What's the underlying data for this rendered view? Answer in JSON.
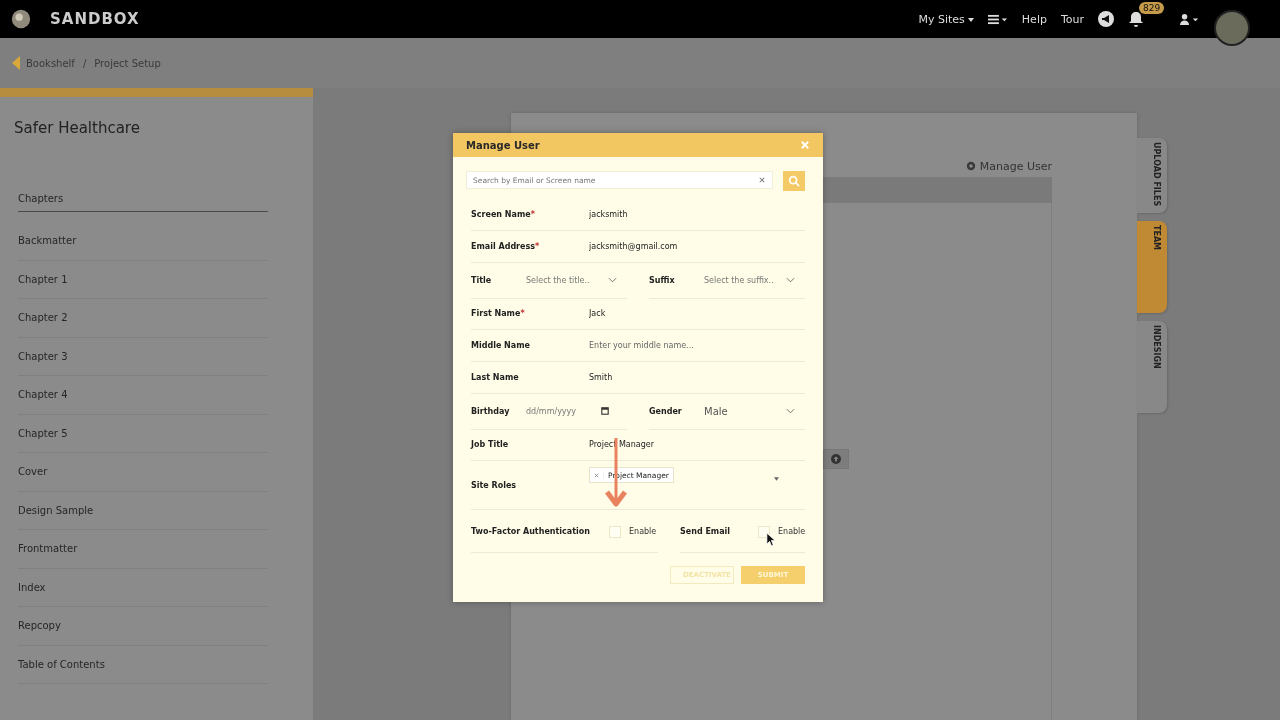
{
  "topbar": {
    "brand": "SANDBOX",
    "nav": [
      {
        "label": "My Sites",
        "caret": true
      },
      {
        "label": "Help",
        "caret": false
      },
      {
        "label": "Tour",
        "caret": false
      }
    ],
    "notification_count": "829"
  },
  "breadcrumb": {
    "items": [
      "Bookshelf",
      "Project Setup"
    ],
    "separator": "/"
  },
  "sidebar": {
    "title": "Safer Healthcare",
    "items": [
      {
        "label": "Chapters",
        "selected": true
      },
      {
        "label": "Backmatter",
        "selected": false
      },
      {
        "label": "Chapter 1",
        "selected": false
      },
      {
        "label": "Chapter 2",
        "selected": false
      },
      {
        "label": "Chapter 3",
        "selected": false
      },
      {
        "label": "Chapter 4",
        "selected": false
      },
      {
        "label": "Chapter 5",
        "selected": false
      },
      {
        "label": "Cover",
        "selected": false
      },
      {
        "label": "Design Sample",
        "selected": false
      },
      {
        "label": "Frontmatter",
        "selected": false
      },
      {
        "label": "Index",
        "selected": false
      },
      {
        "label": "Repcopy",
        "selected": false
      },
      {
        "label": "Table of Contents",
        "selected": false
      }
    ]
  },
  "panel": {
    "heading": "Manage User"
  },
  "side_tabs": [
    {
      "label": "UPLOAD FILES",
      "selected": false
    },
    {
      "label": "TEAM",
      "selected": true
    },
    {
      "label": "INDESIGN",
      "selected": false
    }
  ],
  "modal": {
    "title": "Manage User",
    "search": {
      "placeholder": "Search by Email or Screen name"
    },
    "rows": [
      {
        "kind": "text",
        "label": "Screen Name",
        "required_mark": "*",
        "value": "jacksmith"
      },
      {
        "kind": "text",
        "label": "Email Address",
        "required_mark": "*",
        "value": "jacksmith@gmail.com"
      },
      {
        "kind": "pair",
        "items": [
          {
            "kind": "select",
            "label": "Title",
            "placeholder": "Select the title.."
          },
          {
            "kind": "select",
            "label": "Suffix",
            "placeholder": "Select the suffix.."
          }
        ]
      },
      {
        "kind": "text",
        "label": "First Name",
        "required_mark": "*",
        "value": "Jack"
      },
      {
        "kind": "text",
        "label": "Middle Name",
        "placeholder": "Enter your middle name..."
      },
      {
        "kind": "text",
        "label": "Last Name",
        "value": "Smith"
      },
      {
        "kind": "pair",
        "items": [
          {
            "kind": "date",
            "label": "Birthday",
            "placeholder": "dd/mm/yyyy"
          },
          {
            "kind": "select",
            "label": "Gender",
            "value": "Male"
          }
        ]
      },
      {
        "kind": "text",
        "label": "Job Title",
        "value": "Project Manager"
      },
      {
        "kind": "tags",
        "label": "Site Roles",
        "tags": [
          "Project Manager"
        ]
      },
      {
        "kind": "checks",
        "items": [
          {
            "label": "Two-Factor Authentication",
            "option": "Enable",
            "checked": false
          },
          {
            "label": "Send Email",
            "option": "Enable",
            "checked": false
          }
        ]
      }
    ],
    "buttons": [
      {
        "label": "DEACTIVATE",
        "kind": "outline"
      },
      {
        "label": "SUBMIT",
        "kind": "primary"
      }
    ]
  }
}
